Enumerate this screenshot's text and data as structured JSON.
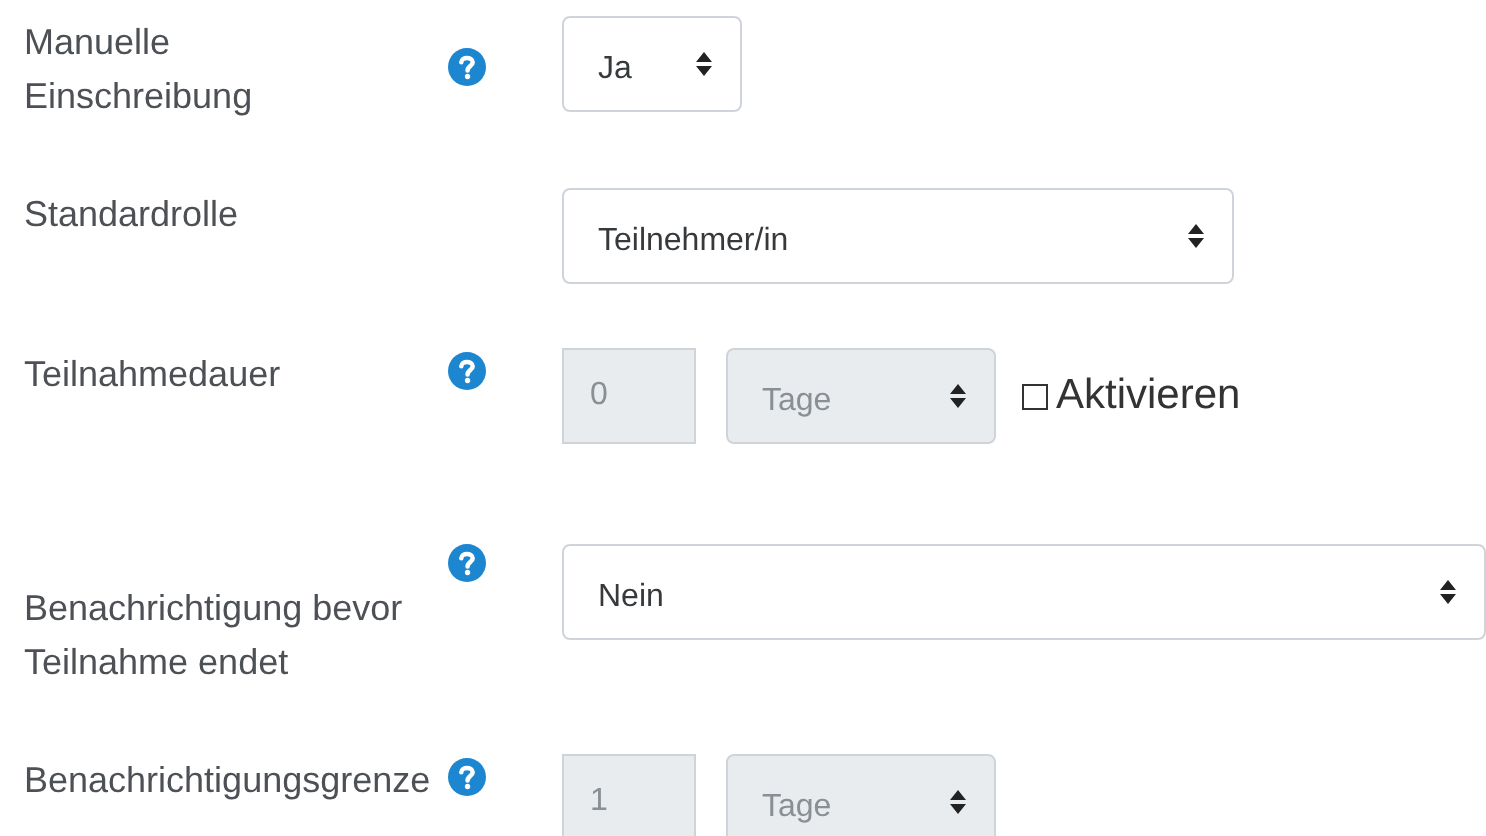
{
  "fields": [
    {
      "kind": "select",
      "label": "Manuelle Einschreibung",
      "help": true,
      "value": "Ja",
      "disabled": false
    },
    {
      "kind": "select",
      "label": "Standardrolle",
      "help": false,
      "value": "Teilnehmer/in",
      "disabled": false
    },
    {
      "kind": "duration",
      "label": "Teilnahmedauer",
      "help": true,
      "number": "0",
      "unit": "Tage",
      "disabled": true,
      "checkbox": {
        "label": "Aktivieren",
        "checked": false
      }
    },
    {
      "kind": "select",
      "label": "Benachrichtigung bevor Teilnahme endet",
      "help": true,
      "value": "Nein",
      "disabled": false
    },
    {
      "kind": "duration",
      "label": "Benachrichtigungsgrenze",
      "help": true,
      "number": "1",
      "unit": "Tage",
      "disabled": true
    }
  ]
}
